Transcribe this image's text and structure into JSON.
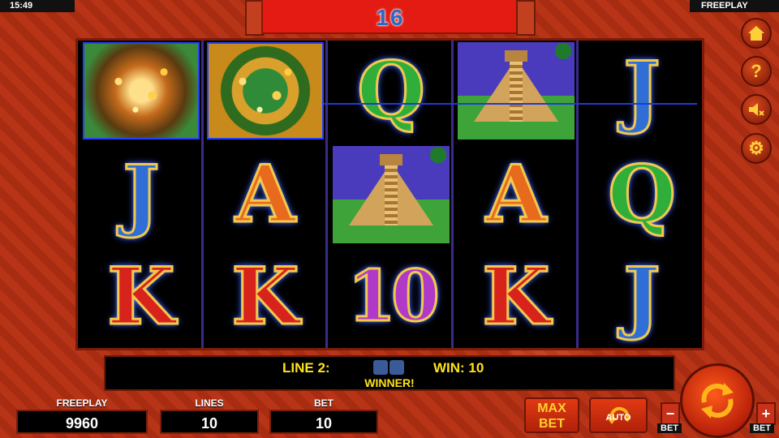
{
  "status_bar": {
    "time": "15:49",
    "mode": "FREEPLAY"
  },
  "freespins_counter": "16",
  "reels": [
    [
      {
        "symbol": "explosion",
        "kind": "special"
      },
      {
        "symbol": "J",
        "kind": "letter"
      },
      {
        "symbol": "K",
        "kind": "letter"
      }
    ],
    [
      {
        "symbol": "calendar-wheel",
        "kind": "special"
      },
      {
        "symbol": "A",
        "kind": "letter"
      },
      {
        "symbol": "K",
        "kind": "letter"
      }
    ],
    [
      {
        "symbol": "Q",
        "kind": "letter"
      },
      {
        "symbol": "pyramid",
        "kind": "pyramid"
      },
      {
        "symbol": "10",
        "kind": "letter"
      }
    ],
    [
      {
        "symbol": "pyramid",
        "kind": "pyramid"
      },
      {
        "symbol": "A",
        "kind": "letter"
      },
      {
        "symbol": "K",
        "kind": "letter"
      }
    ],
    [
      {
        "symbol": "J",
        "kind": "letter"
      },
      {
        "symbol": "Q",
        "kind": "letter"
      },
      {
        "symbol": "J",
        "kind": "letter"
      }
    ]
  ],
  "win_message": {
    "line_label": "LINE 2:",
    "win_label": "WIN: 10",
    "winner_text": "WINNER!"
  },
  "stats": {
    "freeplay": {
      "label": "FREEPLAY",
      "value": "9960"
    },
    "lines": {
      "label": "LINES",
      "value": "10"
    },
    "bet": {
      "label": "BET",
      "value": "10"
    }
  },
  "controls": {
    "max_bet": [
      "MAX",
      "BET"
    ],
    "auto": "AUTO",
    "bet_minus_label": "BET",
    "bet_plus_label": "BET",
    "minus": "−",
    "plus": "+"
  },
  "side_icons": [
    "home-icon",
    "help-icon",
    "sound-muted-icon",
    "settings-gear-icon"
  ],
  "colors": {
    "win_text": "#ffe21a",
    "counter_text": "#2a68c4",
    "payline": "#1d3bd8"
  }
}
